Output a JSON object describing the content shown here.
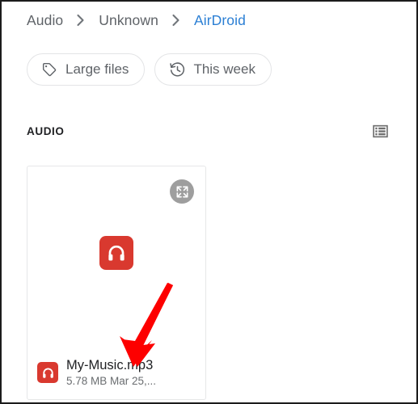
{
  "breadcrumb": {
    "items": [
      {
        "label": "Audio",
        "current": false
      },
      {
        "label": "Unknown",
        "current": false
      },
      {
        "label": "AirDroid",
        "current": true
      }
    ],
    "separator_icon": "chevron-right-icon",
    "current_color": "#2b7fd4",
    "muted_color": "#5f6368"
  },
  "filters": {
    "chips": [
      {
        "label": "Large files",
        "icon": "tag-icon"
      },
      {
        "label": "This week",
        "icon": "history-icon"
      }
    ]
  },
  "section": {
    "title": "AUDIO",
    "view_toggle_icon": "list-view-icon"
  },
  "card": {
    "expand_icon": "expand-arrows-icon",
    "thumb_icon": "headphones-icon",
    "badge_icon": "headphones-icon",
    "badge_color": "#d9392f",
    "file_name": "My-Music.mp3",
    "file_size": "5.78 MB",
    "file_date": "Mar 25,...",
    "file_sub": "5.78 MB  Mar 25,..."
  },
  "annotation": {
    "arrow_color": "#fd0000",
    "arrow_name": "red-pointer-arrow"
  }
}
